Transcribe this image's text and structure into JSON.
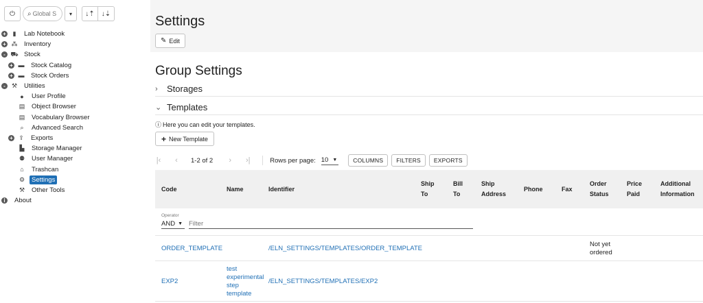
{
  "sidebar": {
    "search": {
      "placeholder": "Global S"
    },
    "icons": {
      "power": "power-icon",
      "search": "search-icon",
      "dropdown": "caret-down-icon",
      "sort_asc": "sort-ascending-icon",
      "sort_desc": "sort-descending-icon"
    },
    "tree": [
      {
        "label": "Lab Notebook",
        "level": 0,
        "expander": "+",
        "icon": "notebook-icon"
      },
      {
        "label": "Inventory",
        "level": 0,
        "expander": "+",
        "icon": "cubes-icon"
      },
      {
        "label": "Stock",
        "level": 0,
        "expander": "-",
        "icon": "cart-icon"
      },
      {
        "label": "Stock Catalog",
        "level": 1,
        "expander": "+",
        "icon": "folder-icon"
      },
      {
        "label": "Stock Orders",
        "level": 1,
        "expander": "+",
        "icon": "folder-icon"
      },
      {
        "label": "Utilities",
        "level": 0,
        "expander": "-",
        "icon": "wrench-icon"
      },
      {
        "label": "User Profile",
        "level": 2,
        "expander": "",
        "icon": "user-icon"
      },
      {
        "label": "Object Browser",
        "level": 2,
        "expander": "",
        "icon": "table-icon"
      },
      {
        "label": "Vocabulary Browser",
        "level": 2,
        "expander": "",
        "icon": "table-icon"
      },
      {
        "label": "Advanced Search",
        "level": 2,
        "expander": "",
        "icon": "search-icon"
      },
      {
        "label": "Exports",
        "level": 1,
        "expander": "+",
        "icon": "export-icon"
      },
      {
        "label": "Storage Manager",
        "level": 2,
        "expander": "",
        "icon": "file-icon"
      },
      {
        "label": "User Manager",
        "level": 2,
        "expander": "",
        "icon": "users-icon"
      },
      {
        "label": "Trashcan",
        "level": 2,
        "expander": "",
        "icon": "trash-icon"
      },
      {
        "label": "Settings",
        "level": 2,
        "expander": "",
        "icon": "gear-icon",
        "selected": true
      },
      {
        "label": "Other Tools",
        "level": 2,
        "expander": "",
        "icon": "wrench-icon"
      },
      {
        "label": "About",
        "level": 0,
        "expander": "i",
        "icon": ""
      }
    ]
  },
  "header": {
    "title": "Settings",
    "edit_label": "Edit"
  },
  "main": {
    "group_title": "Group Settings",
    "sections": {
      "storages": "Storages",
      "templates": "Templates"
    },
    "info_text": "Here you can edit your templates.",
    "new_template_label": "New Template",
    "pager": {
      "range": "1-2 of 2",
      "rows_label": "Rows per page:",
      "rows_value": "10",
      "columns_btn": "COLUMNS",
      "filters_btn": "FILTERS",
      "exports_btn": "EXPORTS"
    },
    "table": {
      "headers": [
        {
          "key": "code",
          "line1": "Code",
          "line2": ""
        },
        {
          "key": "name",
          "line1": "Name",
          "line2": ""
        },
        {
          "key": "identifier",
          "line1": "Identifier",
          "line2": ""
        },
        {
          "key": "ship_to",
          "line1": "Ship",
          "line2": "To"
        },
        {
          "key": "bill_to",
          "line1": "Bill",
          "line2": "To"
        },
        {
          "key": "ship_address",
          "line1": "Ship",
          "line2": "Address"
        },
        {
          "key": "phone",
          "line1": "Phone",
          "line2": ""
        },
        {
          "key": "fax",
          "line1": "Fax",
          "line2": ""
        },
        {
          "key": "order_status",
          "line1": "Order",
          "line2": "Status"
        },
        {
          "key": "price_paid",
          "line1": "Price",
          "line2": "Paid"
        },
        {
          "key": "additional_info",
          "line1": "Additional",
          "line2": "Information"
        }
      ],
      "operator_label": "Operator",
      "operator_value": "AND",
      "filter_placeholder": "Filter",
      "rows": [
        {
          "code": "ORDER_TEMPLATE",
          "name": [],
          "identifier": "/ELN_SETTINGS/TEMPLATES/ORDER_TEMPLATE",
          "order_status": [
            "Not yet",
            "ordered"
          ]
        },
        {
          "code": "EXP2",
          "name": [
            "test",
            "experimental",
            "step",
            "template"
          ],
          "identifier": "/ELN_SETTINGS/TEMPLATES/EXP2",
          "order_status": []
        }
      ]
    }
  },
  "colors": {
    "accent": "#1f6fb5",
    "header_bg": "#f5f5f5",
    "table_header_bg": "#f0f0f0"
  }
}
